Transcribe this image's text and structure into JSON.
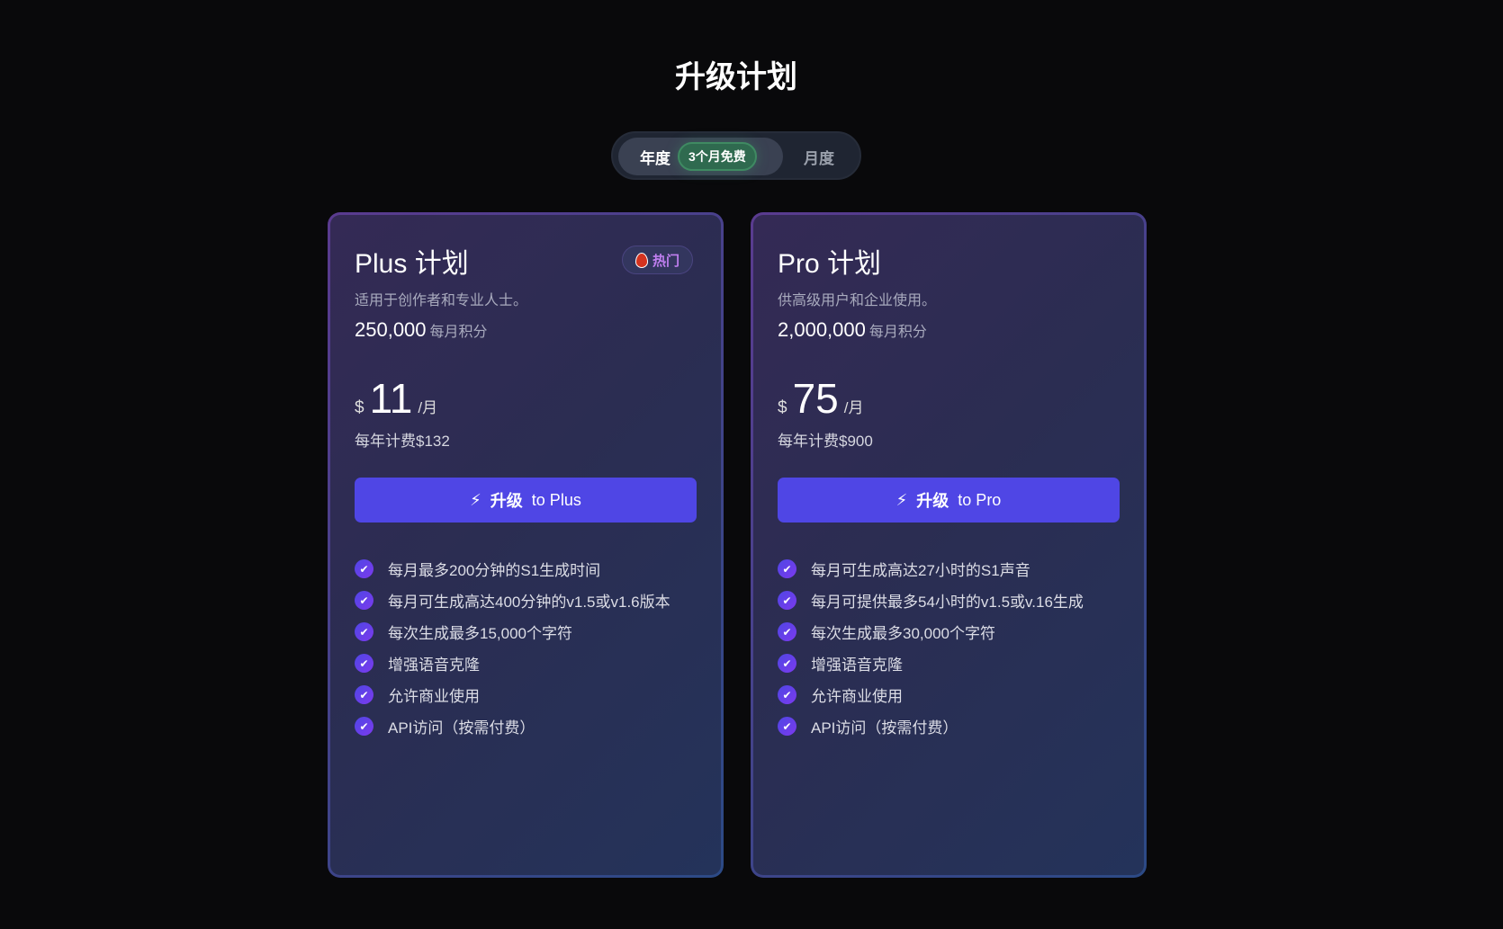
{
  "title": "升级计划",
  "billing_toggle": {
    "annual_label": "年度",
    "annual_badge": "3个月免费",
    "monthly_label": "月度",
    "selected": "年度"
  },
  "plans": [
    {
      "name": "Plus 计划",
      "badge": "热门",
      "description": "适用于创作者和专业人士。",
      "credits": "250,000",
      "credits_unit": "每月积分",
      "currency": "$",
      "price": "11",
      "per": "/月",
      "annual_note": "每年计费$132",
      "button_prefix": "升级",
      "button_suffix": "to Plus",
      "features": [
        "每月最多200分钟的S1生成时间",
        "每月可生成高达400分钟的v1.5或v1.6版本",
        "每次生成最多15,000个字符",
        "增强语音克隆",
        "允许商业使用",
        "API访问（按需付费）"
      ]
    },
    {
      "name": "Pro 计划",
      "description": "供高级用户和企业使用。",
      "credits": "2,000,000",
      "credits_unit": "每月积分",
      "currency": "$",
      "price": "75",
      "per": "/月",
      "annual_note": "每年计费$900",
      "button_prefix": "升级",
      "button_suffix": "to Pro",
      "features": [
        "每月可生成高达27小时的S1声音",
        "每月可提供最多54小时的v1.5或v.16生成",
        "每次生成最多30,000个字符",
        "增强语音克隆",
        "允许商业使用",
        "API访问（按需付费）"
      ]
    }
  ]
}
